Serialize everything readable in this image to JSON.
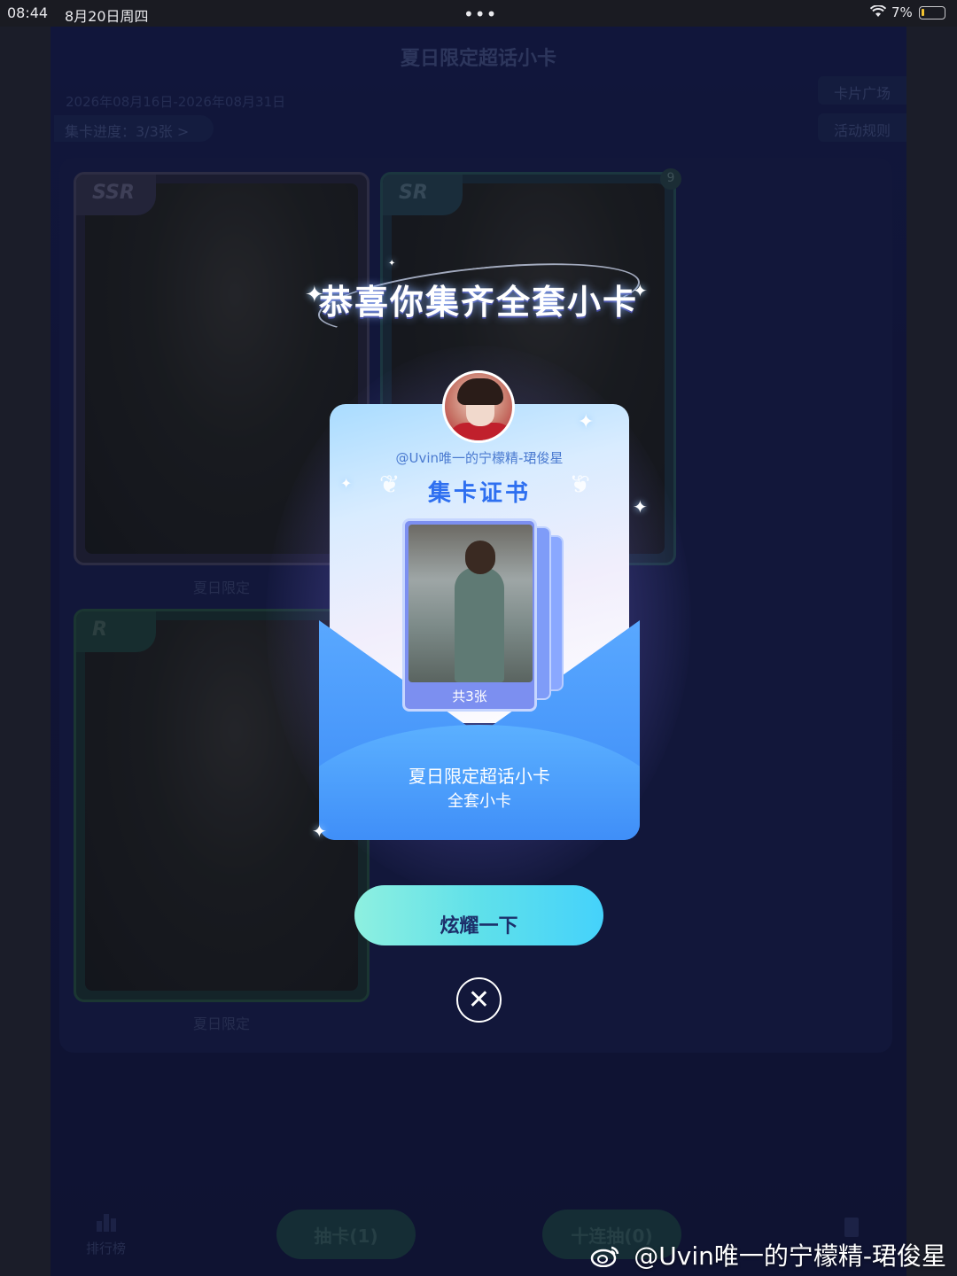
{
  "status_bar": {
    "time": "08:44",
    "date": "8月20日周四",
    "dots": "•••",
    "battery_percent": "7%"
  },
  "page": {
    "title": "夏日限定超话小卡",
    "date_range": "2026年08月16日-2026年08月31日",
    "progress": "集卡进度：3/3张 >",
    "buttons": {
      "card_square": "卡片广场",
      "rules": "活动规则"
    },
    "cards": [
      {
        "rarity": "SSR",
        "caption": "夏日限定"
      },
      {
        "rarity": "SR",
        "caption": "",
        "badge": "9"
      },
      {
        "rarity": "R",
        "caption": "夏日限定"
      }
    ],
    "bottom": {
      "rank_label": "排行榜",
      "draw_one": "抽卡(1)",
      "draw_ten": "十连抽(0)"
    }
  },
  "modal": {
    "congrats_title": "恭喜你集齐全套小卡",
    "username": "@Uvin唯一的宁檬精-珺俊星",
    "certificate_title": "集卡证书",
    "card_count": "共3张",
    "set_name": "夏日限定超话小卡",
    "set_subtitle": "全套小卡",
    "show_button": "炫耀一下",
    "close_icon": "close-icon"
  },
  "watermark": "@Uvin唯一的宁檬精-珺俊星",
  "colors": {
    "accent_button_start": "#8ef0e0",
    "accent_button_end": "#45d2fb",
    "certificate_blue": "#2e6ff0",
    "envelope_blue": "#3f8ef8"
  }
}
